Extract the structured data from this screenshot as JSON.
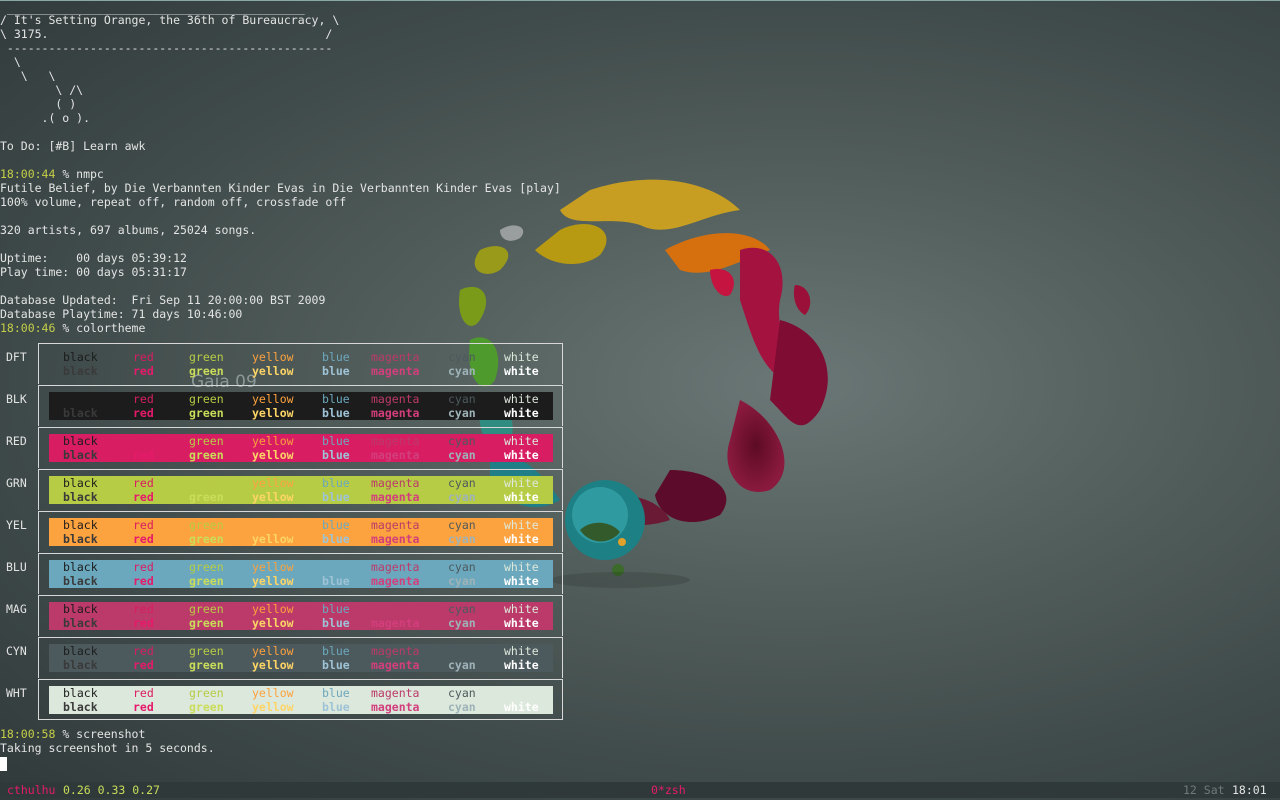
{
  "terminal": {
    "lines": [
      " ___________________________________________",
      "/ It's Setting Orange, the 36th of Bureaucracy, \\",
      "\\ 3175.                                        /",
      " -----------------------------------------------",
      "  \\",
      "   \\   \\",
      "        \\ /\\",
      "        ( )",
      "      .( o ).",
      "",
      "To Do: [#B] Learn awk",
      "",
      "",
      "Futile Belief, by Die Verbannten Kinder Evas in Die Verbannten Kinder Evas [play]",
      "100% volume, repeat off, random off, crossfade off",
      "",
      "320 artists, 697 albums, 25024 songs.",
      "",
      "Uptime:    00 days 05:39:12",
      "Play time: 00 days 05:31:17",
      "",
      "Database Updated:  Fri Sep 11 20:00:00 BST 2009",
      "Database Playtime: 71 days 10:46:00"
    ],
    "prompt1_time": "18:00:44",
    "prompt1_cmd": " % nmpc",
    "prompt2_time": "18:00:46",
    "prompt2_cmd": " % colortheme",
    "prompt3_time": "18:00:58",
    "prompt3_cmd": " % screenshot",
    "screenshot_msg": "Taking screenshot in 5 seconds."
  },
  "wallpaper": {
    "title": "Gaia",
    "version": "09"
  },
  "colortheme": {
    "names": [
      "black",
      "red",
      "green",
      "yellow",
      "blue",
      "magenta",
      "cyan",
      "white"
    ],
    "rows": [
      {
        "label": "DFT",
        "bg": "transparent"
      },
      {
        "label": "BLK",
        "bg": "#1c1c1c"
      },
      {
        "label": "RED",
        "bg": "#d81d62"
      },
      {
        "label": "GRN",
        "bg": "#b7cc45"
      },
      {
        "label": "YEL",
        "bg": "#fca23e"
      },
      {
        "label": "BLU",
        "bg": "#6ba8bd"
      },
      {
        "label": "MAG",
        "bg": "#bb3a69"
      },
      {
        "label": "CYN",
        "bg": "#4d5a5d"
      },
      {
        "label": "WHT",
        "bg": "#dde8dc"
      }
    ],
    "normal_colors": [
      "#1c1c1c",
      "#d81d62",
      "#b7cc45",
      "#fca23e",
      "#6ba8bd",
      "#bb3a69",
      "#4d5a5d",
      "#dde8dc"
    ],
    "bold_colors": [
      "#3a3a3a",
      "#e61a6b",
      "#c9dd5a",
      "#fdd566",
      "#9ec3d6",
      "#d33e7c",
      "#9eb3b8",
      "#ffffff"
    ]
  },
  "statusbar": {
    "host": "cthulhu",
    "load": "0.26 0.33 0.27",
    "window": "0*zsh",
    "date": "12 Sat",
    "time": "18:01"
  }
}
